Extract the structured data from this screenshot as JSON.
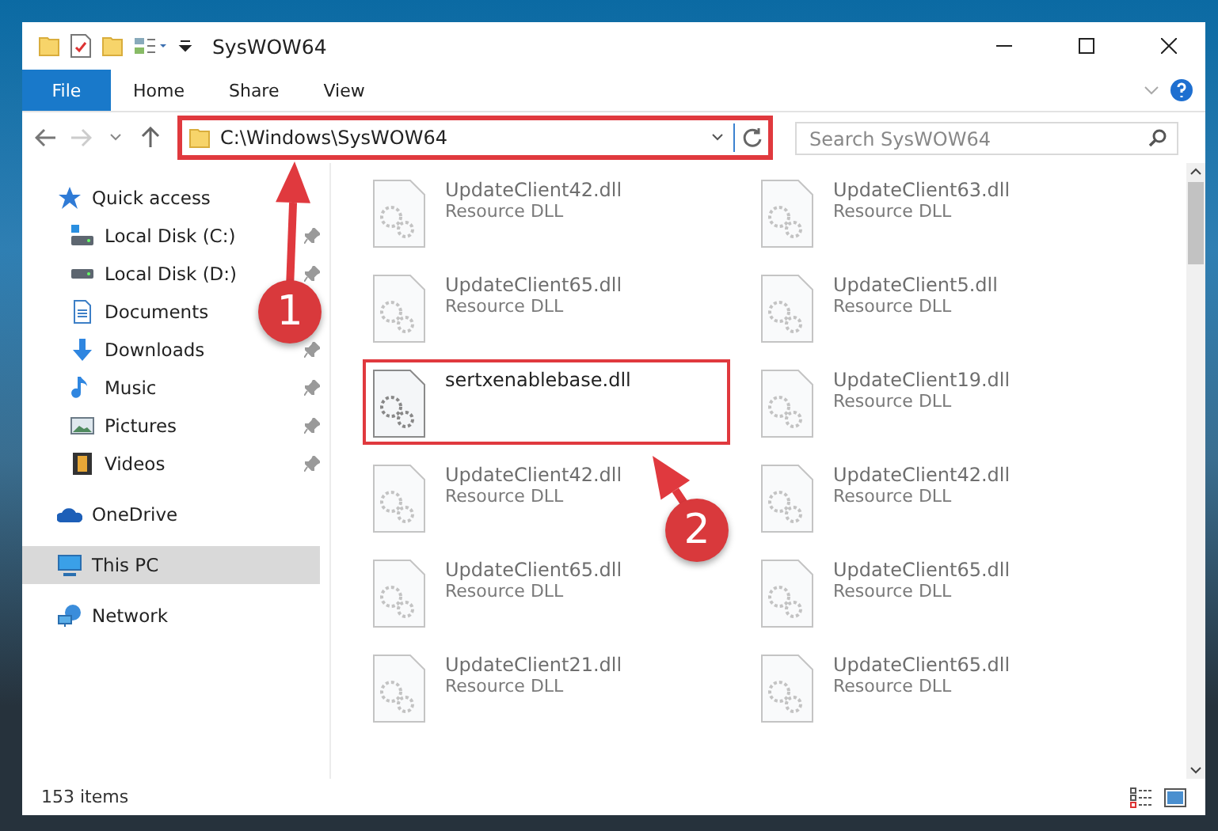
{
  "window": {
    "title": "SysWOW64"
  },
  "ribbon_tabs": [
    {
      "label": "File",
      "kind": "file"
    },
    {
      "label": "Home",
      "kind": "tab"
    },
    {
      "label": "Share",
      "kind": "tab"
    },
    {
      "label": "View",
      "kind": "tab"
    }
  ],
  "address": {
    "path": "C:\\Windows\\SysWOW64",
    "highlighted": true
  },
  "search": {
    "placeholder": "Search SysWOW64"
  },
  "nav": [
    {
      "label": "Quick access",
      "kind": "star",
      "selected": false,
      "children": [
        {
          "label": "Local Disk (C:)",
          "kind": "sysdrive",
          "pinned": true,
          "selected": false
        },
        {
          "label": "Local Disk (D:)",
          "kind": "drive",
          "pinned": true,
          "selected": false
        },
        {
          "label": "Documents",
          "kind": "documents",
          "pinned": false,
          "selected": false
        },
        {
          "label": "Downloads",
          "kind": "downloads",
          "pinned": true,
          "selected": false
        },
        {
          "label": "Music",
          "kind": "music",
          "pinned": true,
          "selected": false
        },
        {
          "label": "Pictures",
          "kind": "pictures",
          "pinned": true,
          "selected": false
        },
        {
          "label": "Videos",
          "kind": "videos",
          "pinned": true,
          "selected": false
        }
      ]
    },
    {
      "label": "OneDrive",
      "kind": "cloud",
      "selected": false
    },
    {
      "label": "This PC",
      "kind": "computer",
      "selected": true
    },
    {
      "label": "Network",
      "kind": "network",
      "selected": false
    }
  ],
  "files": [
    {
      "name": "UpdateClient42.dll",
      "type": "Resource DLL",
      "blurred": true,
      "highlighted": false
    },
    {
      "name": "UpdateClient63.dll",
      "type": "Resource DLL",
      "blurred": true,
      "highlighted": false
    },
    {
      "name": "UpdateClient65.dll",
      "type": "Resource DLL",
      "blurred": true,
      "highlighted": false
    },
    {
      "name": "UpdateClient5.dll",
      "type": "Resource DLL",
      "blurred": true,
      "highlighted": false
    },
    {
      "name": "sertxenablebase.dll",
      "blurred": false,
      "highlighted": true
    },
    {
      "name": "UpdateClient19.dll",
      "type": "Resource DLL",
      "blurred": true,
      "highlighted": false
    },
    {
      "name": "UpdateClient42.dll",
      "type": "Resource DLL",
      "blurred": true,
      "highlighted": false
    },
    {
      "name": "UpdateClient42.dll",
      "type": "Resource DLL",
      "blurred": true,
      "highlighted": false
    },
    {
      "name": "UpdateClient65.dll",
      "type": "Resource DLL",
      "blurred": true,
      "highlighted": false
    },
    {
      "name": "UpdateClient65.dll",
      "type": "Resource DLL",
      "blurred": true,
      "highlighted": false
    },
    {
      "name": "UpdateClient21.dll",
      "type": "Resource DLL",
      "blurred": true,
      "highlighted": false
    },
    {
      "name": "UpdateClient65.dll",
      "type": "Resource DLL",
      "blurred": true,
      "highlighted": false
    }
  ],
  "status_bar": {
    "count": "153 items"
  },
  "annotations": [
    {
      "number": "1"
    },
    {
      "number": "2"
    }
  ]
}
